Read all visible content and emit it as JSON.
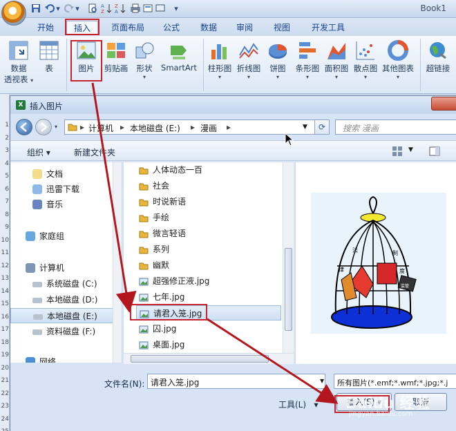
{
  "app": {
    "window_title": "Book1"
  },
  "qat": {
    "icons": [
      "save-icon",
      "undo-icon",
      "redo-icon",
      "print-preview-icon",
      "sort-asc-icon",
      "sort-desc-icon",
      "quick-print-icon",
      "customize-icon"
    ]
  },
  "ribbon_tabs": [
    "开始",
    "插入",
    "页面布局",
    "公式",
    "数据",
    "审阅",
    "视图",
    "开发工具"
  ],
  "active_tab": "插入",
  "ribbon_buttons": {
    "pivot_line1": "数据",
    "pivot_line2": "透视表",
    "table": "表",
    "picture": "图片",
    "clipart": "剪贴画",
    "shapes": "形状",
    "smartart": "SmartArt",
    "column": "柱形图",
    "line": "折线图",
    "pie": "饼图",
    "bar": "条形图",
    "area": "面积图",
    "scatter": "散点图",
    "other": "其他图表",
    "hyperlink": "超链接"
  },
  "dialog": {
    "title": "插入图片",
    "breadcrumb": [
      "计算机",
      "本地磁盘 (E:)",
      "漫画"
    ],
    "search_placeholder": "搜索 漫画",
    "organize": "组织",
    "new_folder": "新建文件夹",
    "nav_items": [
      {
        "label": "文档",
        "icon": "documents-icon"
      },
      {
        "label": "迅雷下载",
        "icon": "download-folder-icon"
      },
      {
        "label": "音乐",
        "icon": "music-icon"
      },
      {
        "label": "家庭组",
        "icon": "homegroup-icon"
      },
      {
        "label": "计算机",
        "icon": "computer-icon"
      },
      {
        "label": "系统磁盘 (C:)",
        "icon": "drive-icon"
      },
      {
        "label": "本地磁盘 (D:)",
        "icon": "drive-icon"
      },
      {
        "label": "本地磁盘 (E:)",
        "icon": "drive-icon"
      },
      {
        "label": "资料磁盘 (F:)",
        "icon": "drive-icon"
      },
      {
        "label": "网络",
        "icon": "network-icon"
      }
    ],
    "files": [
      {
        "label": "人体动态一百",
        "type": "folder"
      },
      {
        "label": "社会",
        "type": "folder"
      },
      {
        "label": "时说新语",
        "type": "folder"
      },
      {
        "label": "手绘",
        "type": "folder"
      },
      {
        "label": "微言轻语",
        "type": "folder"
      },
      {
        "label": "系列",
        "type": "folder"
      },
      {
        "label": "幽默",
        "type": "folder"
      },
      {
        "label": "超强修正液.jpg",
        "type": "image"
      },
      {
        "label": "七年.jpg",
        "type": "image"
      },
      {
        "label": "请君入笼.jpg",
        "type": "image"
      },
      {
        "label": "囚.jpg",
        "type": "image"
      },
      {
        "label": "桌面.jpg",
        "type": "image"
      }
    ],
    "selected_file": "请君入笼.jpg",
    "preview_labels": [
      "法",
      "制",
      "律",
      "度",
      "监管"
    ],
    "filename_label": "文件名(N):",
    "filename_value": "请君入笼.jpg",
    "filetype_value": "所有图片(*.emf;*.wmf;*.jpg;*.j",
    "tools_label": "工具(L)",
    "insert_label": "插入(S)",
    "cancel_label": "取消"
  },
  "row_numbers": [
    "1",
    "2",
    "3",
    "4",
    "5",
    "6",
    "7",
    "8",
    "9",
    "10",
    "11",
    "12",
    "13",
    "14",
    "15",
    "16",
    "17",
    "18",
    "19",
    "20",
    "21",
    "22",
    "23",
    "24",
    "25"
  ],
  "watermark": {
    "main": "Baidu 经验",
    "sub": "jingyan.baidu.com"
  },
  "colors": {
    "highlight_red": "#c8232c",
    "arrow_red": "#b3161c",
    "ribbon_text": "#15428b"
  }
}
